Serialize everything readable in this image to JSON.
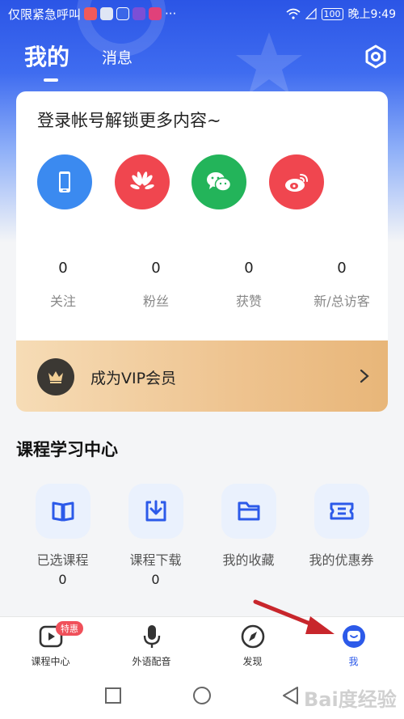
{
  "status_bar": {
    "left_text": "仅限紧急呼叫",
    "more": "···",
    "battery": "100",
    "time": "晚上9:49"
  },
  "top_nav": {
    "tab_mine": "我的",
    "tab_messages": "消息",
    "settings_icon": "hexagon-settings-icon"
  },
  "login_card": {
    "title": "登录帐号解锁更多内容~",
    "login_methods": [
      {
        "icon": "phone-icon",
        "color": "#3b8af0"
      },
      {
        "icon": "huawei-icon",
        "color": "#f0464f"
      },
      {
        "icon": "wechat-icon",
        "color": "#23b45a"
      },
      {
        "icon": "weibo-icon",
        "color": "#f0464f"
      }
    ],
    "stats": [
      {
        "value": "0",
        "label": "关注"
      },
      {
        "value": "0",
        "label": "粉丝"
      },
      {
        "value": "0",
        "label": "获赞"
      },
      {
        "value": "0",
        "label": "新/总访客"
      }
    ],
    "vip": {
      "label": "成为VIP会员",
      "icon": "crown-icon"
    }
  },
  "course_center": {
    "title": "课程学习中心",
    "items": [
      {
        "label": "已选课程",
        "count": "0",
        "icon": "book-icon"
      },
      {
        "label": "课程下载",
        "count": "0",
        "icon": "download-icon"
      },
      {
        "label": "我的收藏",
        "count": "",
        "icon": "folder-icon"
      },
      {
        "label": "我的优惠券",
        "count": "",
        "icon": "coupon-icon"
      }
    ]
  },
  "tab_bar": {
    "items": [
      {
        "label": "课程中心",
        "icon": "play-icon",
        "badge": "特惠"
      },
      {
        "label": "外语配音",
        "icon": "microphone-icon"
      },
      {
        "label": "发现",
        "icon": "compass-icon"
      },
      {
        "label": "我",
        "icon": "me-face-icon",
        "active": true
      }
    ]
  },
  "watermark": "Bai度经验",
  "colors": {
    "primary": "#2c5ae9",
    "vip_gold": "#eec38f",
    "annotation_red": "#c8262c"
  }
}
